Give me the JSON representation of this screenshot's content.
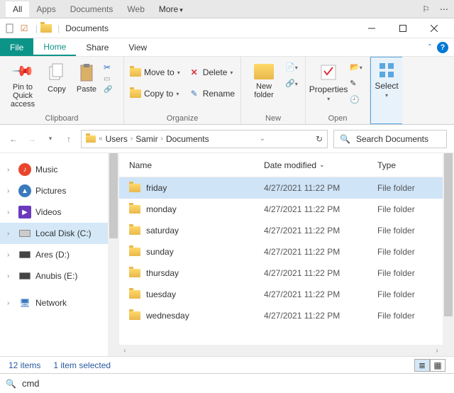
{
  "top_tabs": {
    "all": "All",
    "apps": "Apps",
    "documents": "Documents",
    "web": "Web",
    "more": "More"
  },
  "title": "Documents",
  "ribbon_tabs": {
    "file": "File",
    "home": "Home",
    "share": "Share",
    "view": "View"
  },
  "ribbon": {
    "pin": "Pin to Quick access",
    "copy": "Copy",
    "paste": "Paste",
    "clipboard_label": "Clipboard",
    "moveto": "Move to",
    "copyto": "Copy to",
    "delete": "Delete",
    "rename": "Rename",
    "organize_label": "Organize",
    "newfolder": "New folder",
    "new_label": "New",
    "properties": "Properties",
    "open_label": "Open",
    "select": "Select"
  },
  "breadcrumb": {
    "users": "Users",
    "samir": "Samir",
    "documents": "Documents"
  },
  "search_placeholder": "Search Documents",
  "tree": {
    "music": "Music",
    "pictures": "Pictures",
    "videos": "Videos",
    "localdisk": "Local Disk (C:)",
    "ares": "Ares (D:)",
    "anubis": "Anubis (E:)",
    "network": "Network"
  },
  "columns": {
    "name": "Name",
    "date": "Date modified",
    "type": "Type"
  },
  "files": [
    {
      "name": "friday",
      "date": "4/27/2021 11:22 PM",
      "type": "File folder",
      "sel": true
    },
    {
      "name": "monday",
      "date": "4/27/2021 11:22 PM",
      "type": "File folder",
      "sel": false
    },
    {
      "name": "saturday",
      "date": "4/27/2021 11:22 PM",
      "type": "File folder",
      "sel": false
    },
    {
      "name": "sunday",
      "date": "4/27/2021 11:22 PM",
      "type": "File folder",
      "sel": false
    },
    {
      "name": "thursday",
      "date": "4/27/2021 11:22 PM",
      "type": "File folder",
      "sel": false
    },
    {
      "name": "tuesday",
      "date": "4/27/2021 11:22 PM",
      "type": "File folder",
      "sel": false
    },
    {
      "name": "wednesday",
      "date": "4/27/2021 11:22 PM",
      "type": "File folder",
      "sel": false
    }
  ],
  "status": {
    "items": "12 items",
    "selected": "1 item selected"
  },
  "cmd": "cmd"
}
